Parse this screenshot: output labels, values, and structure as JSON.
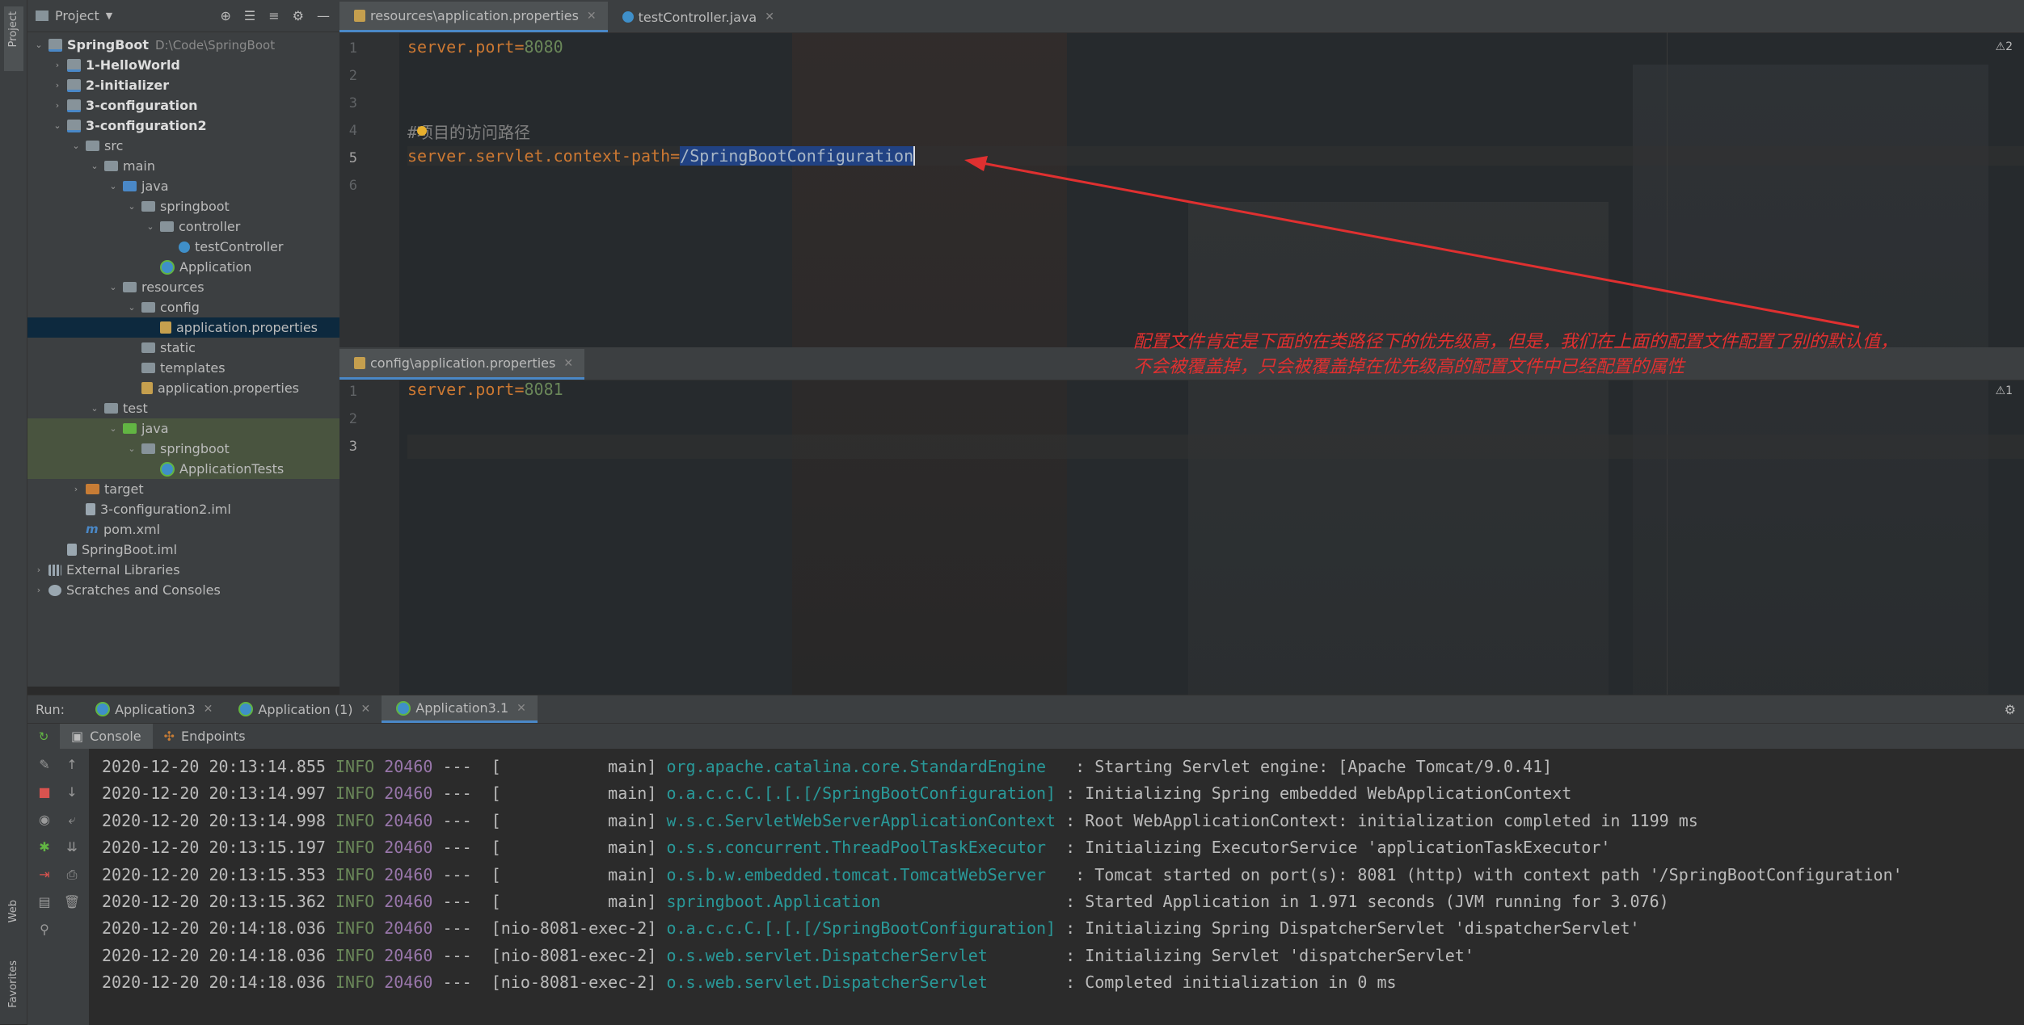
{
  "side_tool_labels": {
    "project": "Project",
    "web": "Web",
    "favorites": "Favorites"
  },
  "project": {
    "title": "Project",
    "tree": [
      {
        "label": "SpringBoot",
        "hint": "D:\\Code\\SpringBoot",
        "icon": "module",
        "depth": 0,
        "expanded": true,
        "bold": true
      },
      {
        "label": "1-HelloWorld",
        "icon": "module",
        "depth": 1,
        "expanded": false,
        "bold": true
      },
      {
        "label": "2-initializer",
        "icon": "module",
        "depth": 1,
        "expanded": false,
        "bold": true
      },
      {
        "label": "3-configuration",
        "icon": "module",
        "depth": 1,
        "expanded": false,
        "bold": true
      },
      {
        "label": "3-configuration2",
        "icon": "module",
        "depth": 1,
        "expanded": true,
        "bold": true
      },
      {
        "label": "src",
        "icon": "folder",
        "depth": 2,
        "expanded": true
      },
      {
        "label": "main",
        "icon": "folder",
        "depth": 3,
        "expanded": true
      },
      {
        "label": "java",
        "icon": "folder-blue",
        "depth": 4,
        "expanded": true
      },
      {
        "label": "springboot",
        "icon": "folder",
        "depth": 5,
        "expanded": true
      },
      {
        "label": "controller",
        "icon": "folder",
        "depth": 6,
        "expanded": true
      },
      {
        "label": "testController",
        "icon": "class",
        "depth": 7
      },
      {
        "label": "Application",
        "icon": "app",
        "depth": 6
      },
      {
        "label": "resources",
        "icon": "folder",
        "depth": 4,
        "expanded": true
      },
      {
        "label": "config",
        "icon": "folder",
        "depth": 5,
        "expanded": true
      },
      {
        "label": "application.properties",
        "icon": "props",
        "depth": 6,
        "selected": true
      },
      {
        "label": "static",
        "icon": "folder",
        "depth": 5
      },
      {
        "label": "templates",
        "icon": "folder",
        "depth": 5
      },
      {
        "label": "application.properties",
        "icon": "props",
        "depth": 5
      },
      {
        "label": "test",
        "icon": "folder",
        "depth": 3,
        "expanded": true
      },
      {
        "label": "java",
        "icon": "folder-green",
        "depth": 4,
        "expanded": true,
        "test": true
      },
      {
        "label": "springboot",
        "icon": "folder",
        "depth": 5,
        "expanded": true,
        "test": true
      },
      {
        "label": "ApplicationTests",
        "icon": "app",
        "depth": 6,
        "test": true
      },
      {
        "label": "target",
        "icon": "folder-orange",
        "depth": 2,
        "expanded": false
      },
      {
        "label": "3-configuration2.iml",
        "icon": "file",
        "depth": 2
      },
      {
        "label": "pom.xml",
        "icon": "maven",
        "depth": 2
      },
      {
        "label": "SpringBoot.iml",
        "icon": "file",
        "depth": 1
      },
      {
        "label": "External Libraries",
        "icon": "lib",
        "depth": 0,
        "expanded": false
      },
      {
        "label": "Scratches and Consoles",
        "icon": "scratch",
        "depth": 0,
        "expanded": false
      }
    ]
  },
  "editor_top": {
    "tabs": [
      {
        "label": "resources\\application.properties",
        "active": true
      },
      {
        "label": "testController.java",
        "active": false
      }
    ],
    "warning": "⚠2",
    "line_numbers": [
      "1",
      "2",
      "3",
      "4",
      "5",
      "6"
    ],
    "line1": {
      "key": "server.port=",
      "value": "8080"
    },
    "line4": {
      "comment": "#项目的访问路径"
    },
    "line5": {
      "key": "server.servlet.context-path=",
      "value": "/SpringBootConfiguration"
    }
  },
  "editor_bottom": {
    "tabs": [
      {
        "label": "config\\application.properties",
        "active": true
      }
    ],
    "warning": "⚠1",
    "line_numbers": [
      "1",
      "2",
      "3"
    ],
    "line1": {
      "key": "server.port=",
      "value": "8081"
    }
  },
  "annotation": {
    "line1": "配置文件肯定是下面的在类路径下的优先级高，但是，我们在上面的配置文件配置了别的默认值，",
    "line2": "不会被覆盖掉，只会被覆盖掉在优先级高的配置文件中已经配置的属性",
    "color": "#e03030"
  },
  "run": {
    "label": "Run:",
    "tabs": [
      {
        "label": "Application3",
        "active": false
      },
      {
        "label": "Application (1)",
        "active": false
      },
      {
        "label": "Application3.1",
        "active": true
      }
    ],
    "subtabs": [
      "Console",
      "Endpoints"
    ],
    "log": [
      {
        "ts": "2020-12-20 20:13:14.855",
        "level": "INFO",
        "pid": "20460",
        "thread": "---  [           main]",
        "logger": "org.apache.catalina.core.StandardEngine  ",
        "msg": ": Starting Servlet engine: [Apache Tomcat/9.0.41]"
      },
      {
        "ts": "2020-12-20 20:13:14.997",
        "level": "INFO",
        "pid": "20460",
        "thread": "---  [           main]",
        "logger": "o.a.c.c.C.[.[.[/SpringBootConfiguration]",
        "msg": ": Initializing Spring embedded WebApplicationContext"
      },
      {
        "ts": "2020-12-20 20:13:14.998",
        "level": "INFO",
        "pid": "20460",
        "thread": "---  [           main]",
        "logger": "w.s.c.ServletWebServerApplicationContext",
        "msg": ": Root WebApplicationContext: initialization completed in 1199 ms"
      },
      {
        "ts": "2020-12-20 20:13:15.197",
        "level": "INFO",
        "pid": "20460",
        "thread": "---  [           main]",
        "logger": "o.s.s.concurrent.ThreadPoolTaskExecutor ",
        "msg": ": Initializing ExecutorService 'applicationTaskExecutor'"
      },
      {
        "ts": "2020-12-20 20:13:15.353",
        "level": "INFO",
        "pid": "20460",
        "thread": "---  [           main]",
        "logger": "o.s.b.w.embedded.tomcat.TomcatWebServer  ",
        "msg": ": Tomcat started on port(s): 8081 (http) with context path '/SpringBootConfiguration'"
      },
      {
        "ts": "2020-12-20 20:13:15.362",
        "level": "INFO",
        "pid": "20460",
        "thread": "---  [           main]",
        "logger": "springboot.Application                  ",
        "msg": ": Started Application in 1.971 seconds (JVM running for 3.076)"
      },
      {
        "ts": "2020-12-20 20:14:18.036",
        "level": "INFO",
        "pid": "20460",
        "thread": "---  [nio-8081-exec-2]",
        "logger": "o.a.c.c.C.[.[.[/SpringBootConfiguration]",
        "msg": ": Initializing Spring DispatcherServlet 'dispatcherServlet'"
      },
      {
        "ts": "2020-12-20 20:14:18.036",
        "level": "INFO",
        "pid": "20460",
        "thread": "---  [nio-8081-exec-2]",
        "logger": "o.s.web.servlet.DispatcherServlet       ",
        "msg": ": Initializing Servlet 'dispatcherServlet'"
      },
      {
        "ts": "2020-12-20 20:14:18.036",
        "level": "INFO",
        "pid": "20460",
        "thread": "---  [nio-8081-exec-2]",
        "logger": "o.s.web.servlet.DispatcherServlet       ",
        "msg": ": Completed initialization in 0 ms"
      }
    ]
  },
  "colors": {
    "selection": "#214283",
    "tree_selected": "#0d293e",
    "test_bg": "#49543f",
    "keyword": "#cc7832",
    "string": "#6a8759",
    "logger": "#299999"
  }
}
